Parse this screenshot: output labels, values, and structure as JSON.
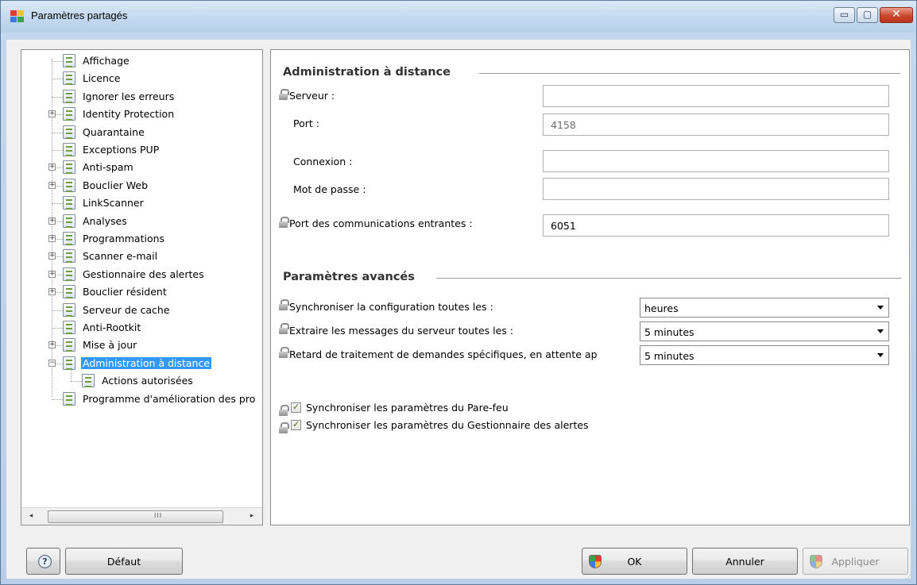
{
  "window": {
    "title": "Paramètres partagés",
    "minimize_glyph": "▭",
    "maximize_glyph": "▢",
    "close_glyph": "✕"
  },
  "tree": {
    "items": [
      {
        "label": "Affichage",
        "expander": "",
        "selected": false
      },
      {
        "label": "Licence",
        "expander": "",
        "selected": false
      },
      {
        "label": "Ignorer les erreurs",
        "expander": "",
        "selected": false
      },
      {
        "label": "Identity Protection",
        "expander": "+",
        "selected": false
      },
      {
        "label": "Quarantaine",
        "expander": "",
        "selected": false
      },
      {
        "label": "Exceptions PUP",
        "expander": "",
        "selected": false
      },
      {
        "label": "Anti-spam",
        "expander": "+",
        "selected": false
      },
      {
        "label": "Bouclier Web",
        "expander": "+",
        "selected": false
      },
      {
        "label": "LinkScanner",
        "expander": "",
        "selected": false
      },
      {
        "label": "Analyses",
        "expander": "+",
        "selected": false
      },
      {
        "label": "Programmations",
        "expander": "+",
        "selected": false
      },
      {
        "label": "Scanner e-mail",
        "expander": "+",
        "selected": false
      },
      {
        "label": "Gestionnaire des alertes",
        "expander": "+",
        "selected": false
      },
      {
        "label": "Bouclier résident",
        "expander": "+",
        "selected": false
      },
      {
        "label": "Serveur de cache",
        "expander": "",
        "selected": false
      },
      {
        "label": "Anti-Rootkit",
        "expander": "",
        "selected": false
      },
      {
        "label": "Mise à jour",
        "expander": "+",
        "selected": false
      },
      {
        "label": "Administration à distance",
        "expander": "−",
        "selected": true
      },
      {
        "label": "Actions autorisées",
        "expander": "",
        "selected": false
      },
      {
        "label": "Programme d'amélioration des pro",
        "expander": "",
        "selected": false
      }
    ],
    "scroll_left": "◂",
    "scroll_right": "▸",
    "scroll_grip": "III"
  },
  "remote_admin": {
    "section_title": "Administration à distance",
    "server_label": "Serveur :",
    "server_value": "",
    "port_label": "Port :",
    "port_value": "4158",
    "login_label": "Connexion :",
    "login_value": "",
    "password_label": "Mot de passe :",
    "password_value": "",
    "incoming_port_label": "Port des communications entrantes :",
    "incoming_port_value": "6051"
  },
  "advanced": {
    "section_title": "Paramètres avancés",
    "sync_config_label": "Synchroniser la configuration toutes les :",
    "sync_config_value": "heures",
    "fetch_messages_label": "Extraire les messages du serveur toutes les :",
    "fetch_messages_value": "5 minutes",
    "delay_label": "Retard de traitement de demandes spécifiques, en attente ap",
    "delay_value": "5 minutes",
    "sync_firewall_label": "Synchroniser les paramètres du Pare-feu",
    "sync_firewall_checked": true,
    "sync_alerts_label": "Synchroniser les paramètres du Gestionnaire des alertes",
    "sync_alerts_checked": true,
    "check_mark": "✓"
  },
  "footer": {
    "help_glyph": "?",
    "default_label": "Défaut",
    "ok_label": "OK",
    "cancel_label": "Annuler",
    "apply_label": "Appliquer",
    "resize_glyph": "⋰"
  }
}
